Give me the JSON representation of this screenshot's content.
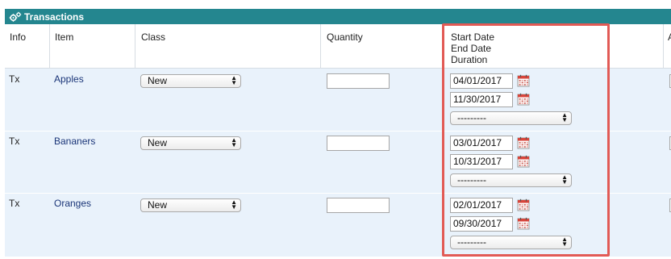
{
  "panel": {
    "title": "Transactions",
    "icon": "gear-icon"
  },
  "columns": {
    "info": "Info",
    "item": "Item",
    "class": "Class",
    "quantity": "Quantity",
    "dates": [
      "Start Date",
      "End Date",
      "Duration"
    ],
    "next": "A"
  },
  "rows": [
    {
      "info": "Tx",
      "item": "Apples",
      "class": "New",
      "quantity": "",
      "start": "04/01/2017",
      "end": "11/30/2017",
      "duration": "---------"
    },
    {
      "info": "Tx",
      "item": "Bananers",
      "class": "New",
      "quantity": "",
      "start": "03/01/2017",
      "end": "10/31/2017",
      "duration": "---------"
    },
    {
      "info": "Tx",
      "item": "Oranges",
      "class": "New",
      "quantity": "",
      "start": "02/01/2017",
      "end": "09/30/2017",
      "duration": "---------"
    }
  ],
  "colors": {
    "titlebar": "#24868f",
    "row_background": "#e9f2fb",
    "highlight": "#e25a55",
    "link": "#1a3578"
  }
}
